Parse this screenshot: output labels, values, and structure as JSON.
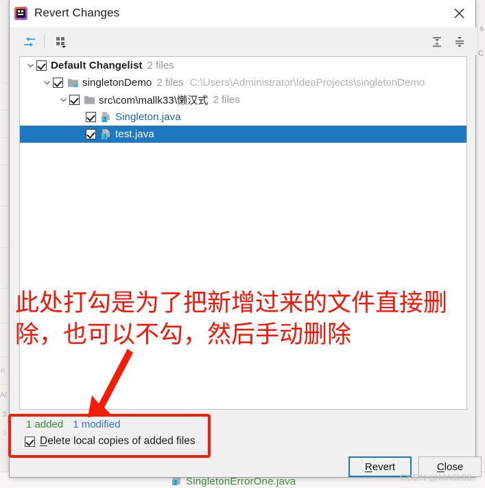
{
  "window": {
    "title": "Revert Changes",
    "app_icon": "intellij-idea-logo",
    "close_icon": "close-icon"
  },
  "toolbar": {
    "buttons": [
      {
        "name": "collapse-arrows-icon",
        "tooltip": "Show Diff"
      },
      {
        "name": "group-by-icon",
        "tooltip": "Group By"
      },
      {
        "name": "expand-all-icon",
        "tooltip": "Expand All"
      },
      {
        "name": "collapse-all-icon",
        "tooltip": "Collapse All"
      }
    ]
  },
  "tree": {
    "rows": [
      {
        "label": "Default Changelist",
        "sub": "2 files",
        "path": "",
        "icon": "none",
        "checked": true,
        "expanded": true,
        "selected": false,
        "style": "bold",
        "indent": 0
      },
      {
        "label": "singletonDemo",
        "sub": "2 files",
        "path": "C:\\Users\\Administrator\\IdeaProjects\\singletonDemo",
        "icon": "module-folder-icon",
        "checked": true,
        "expanded": true,
        "selected": false,
        "style": "plain",
        "indent": 1
      },
      {
        "label": "src\\com\\mallk33\\懒汉式",
        "sub": "2 files",
        "path": "",
        "icon": "folder-icon",
        "checked": true,
        "expanded": true,
        "selected": false,
        "style": "plain",
        "indent": 2
      },
      {
        "label": "Singleton.java",
        "sub": "",
        "path": "",
        "icon": "java-file-icon",
        "checked": true,
        "expanded": null,
        "selected": false,
        "style": "link",
        "indent": 3
      },
      {
        "label": "test.java",
        "sub": "",
        "path": "",
        "icon": "java-file-icon",
        "checked": true,
        "expanded": null,
        "selected": true,
        "style": "onsel",
        "indent": 3
      }
    ]
  },
  "annotation": {
    "line1": "此处打勾是为了把新增过来的文件直接删",
    "line2": "除，也可以不勾，然后手动删除",
    "color": "#fa1405",
    "arrow": "red-arrow-annotation",
    "highlight_box": "red-highlight-box"
  },
  "status": {
    "added": "1 added",
    "modified": "1 modified",
    "added_color": "#2e8b2e",
    "modified_color": "#2d77c4"
  },
  "delete_option": {
    "mnemonic": "D",
    "label_rest": "elete local copies of added files",
    "checked": true
  },
  "footer": {
    "revert": {
      "mnemonic": "R",
      "rest": "evert",
      "focused": true
    },
    "close": {
      "mnemonic": "C",
      "rest": "lose",
      "focused": false
    }
  },
  "watermark": "CSDN @MAllk33",
  "background": {
    "ghost_file": "SingletonErrorOne.java",
    "left_labels": [
      "n",
      "Al",
      "3",
      "3"
    ],
    "right_labels": [
      "s",
      "C"
    ]
  }
}
